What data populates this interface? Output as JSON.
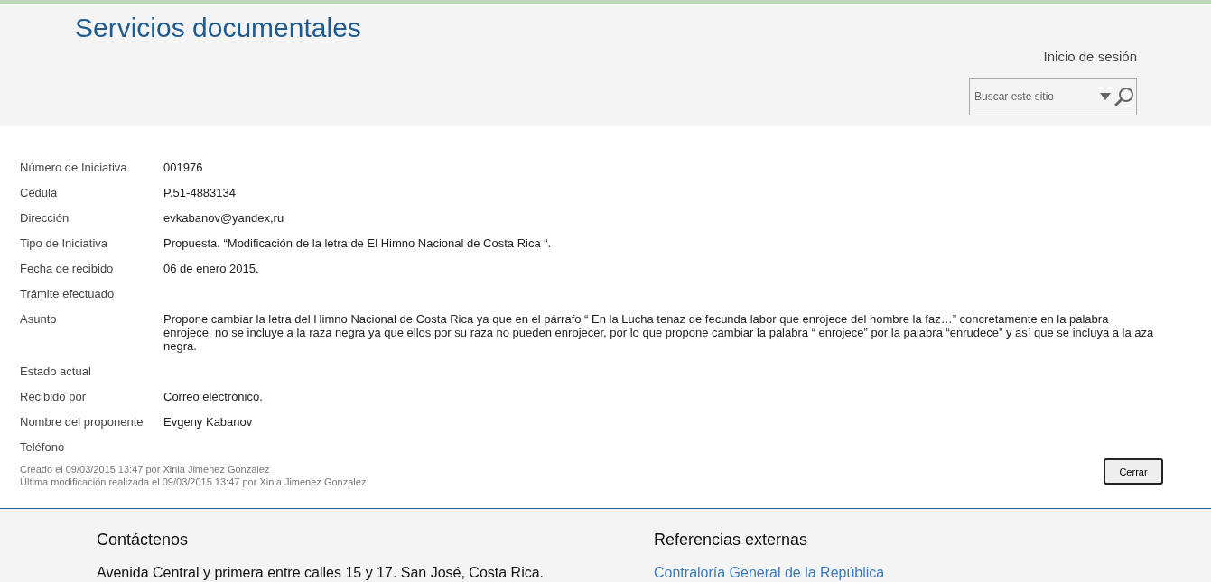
{
  "header": {
    "site_title": "Servicios documentales",
    "login_link": "Inicio de sesión",
    "search": {
      "placeholder": "Buscar este sitio"
    }
  },
  "fields": [
    {
      "label": "Número de Iniciativa",
      "value": "001976"
    },
    {
      "label": "Cédula",
      "value": "P.51-4883134"
    },
    {
      "label": "Dirección",
      "value": "evkabanov@yandex,ru"
    },
    {
      "label": "Tipo de Iniciativa",
      "value": "Propuesta. “Modificación de la letra de El Himno Nacional de Costa Rica “."
    },
    {
      "label": "Fecha de recibido",
      "value": "06 de enero 2015."
    },
    {
      "label": "Trámite efectuado"
    },
    {
      "label": "Asunto",
      "value": "Propone cambiar la letra del Himno Nacional de Costa Rica ya que en el párrafo “ En la Lucha tenaz de fecunda labor que enrojece del hombre la faz…” concretamente en la palabra enrojece, no se incluye a la raza negra ya que ellos por su raza no pueden enrojecer, por lo que propone cambiar la palabra “ enrojece” por la palabra “enrudece” y así que se incluya a la aza negra."
    },
    {
      "label": "Estado actual"
    },
    {
      "label": "Recibido por",
      "value": "Correo electrónico."
    },
    {
      "label": "Nombre del proponente",
      "value": "Evgeny Kabanov"
    },
    {
      "label": "Teléfono"
    }
  ],
  "meta": [
    "Creado el 09/03/2015 13:47  por Xinia Jimenez Gonzalez",
    "Última modificación realizada el 09/03/2015 13:47  por Xinia Jimenez Gonzalez"
  ],
  "close_button": "Cerrar",
  "footer": {
    "columns": [
      {
        "heading": "Contáctenos",
        "items": [
          {
            "kind": "text",
            "text": "Avenida Central y primera entre calles 15 y 17. San José, Costa Rica."
          }
        ]
      },
      {
        "heading": "Referencias externas",
        "items": [
          {
            "kind": "link",
            "text": "Contraloría General de la República"
          }
        ]
      }
    ]
  }
}
